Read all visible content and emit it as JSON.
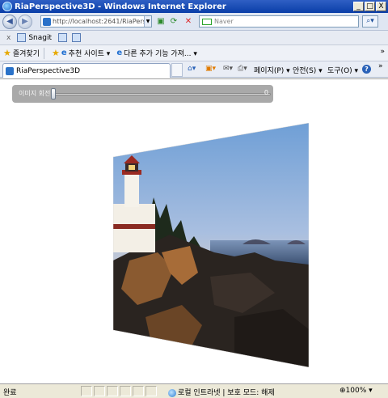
{
  "window": {
    "title": "RiaPerspective3D - Windows Internet Explorer",
    "minimize": "_",
    "maximize": "□",
    "close": "X"
  },
  "address": {
    "url": "http://localhost:2641/RiaPers",
    "search_placeholder": "Naver"
  },
  "links_bar": {
    "close": "x",
    "snagit": "Snagit"
  },
  "favorites": {
    "favorites_label": "즐겨찾기",
    "suggested_sites": "추천 사이트 ▾",
    "get_more_addons": "다른 추가 기능 가져... ▾",
    "more": "»"
  },
  "tab": {
    "title": "RiaPerspective3D"
  },
  "commands": {
    "page": "페이지(P) ▾",
    "safety": "안전(S) ▾",
    "tools": "도구(O) ▾",
    "help": "?",
    "overflow": "»"
  },
  "slider": {
    "label": "이미지 회전",
    "value": "0",
    "level_percent": 0
  },
  "photo": {
    "subject": "lighthouse-on-rocky-coast"
  },
  "status": {
    "done": "완료",
    "zone": "로컬 인트라넷 | 보호 모드: 해제",
    "zoom": "100%"
  },
  "colors": {
    "titlebar": "#0a3ea8",
    "slider_panel": "#a9a9a9"
  }
}
